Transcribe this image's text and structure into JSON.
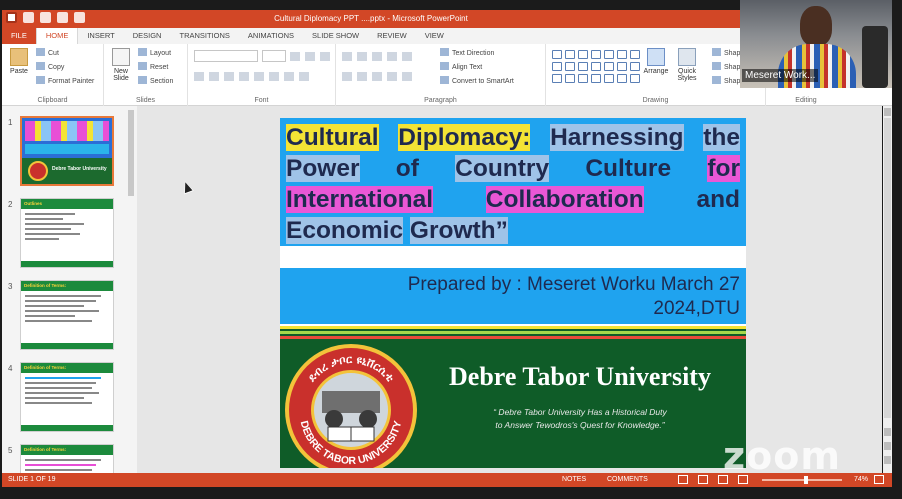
{
  "window": {
    "title": "Cultural Diplomacy  PPT ....pptx - Microsoft PowerPoint"
  },
  "ribbon_tabs": [
    "FILE",
    "HOME",
    "INSERT",
    "DESIGN",
    "TRANSITIONS",
    "ANIMATIONS",
    "SLIDE SHOW",
    "REVIEW",
    "VIEW"
  ],
  "active_tab": "HOME",
  "ribbon": {
    "clipboard": {
      "paste": "Paste",
      "cut": "Cut",
      "copy": "Copy",
      "format_painter": "Format Painter",
      "label": "Clipboard"
    },
    "slides": {
      "new_slide": "New Slide",
      "layout": "Layout",
      "reset": "Reset",
      "section": "Section",
      "label": "Slides"
    },
    "font": {
      "label": "Font"
    },
    "paragraph": {
      "text_direction": "Text Direction",
      "align_text": "Align Text",
      "convert_smartart": "Convert to SmartArt",
      "label": "Paragraph"
    },
    "drawing": {
      "arrange": "Arrange",
      "quick_styles": "Quick Styles",
      "shape_fill": "Shape F",
      "shape_outline": "Shape O",
      "shape_effects": "Shape E",
      "label": "Drawing"
    },
    "editing": {
      "label": "Editing"
    }
  },
  "webcam": {
    "participant_name": "Meseret Work..."
  },
  "thumbnails": [
    {
      "number": "1",
      "caption": "Debre Tabor University"
    },
    {
      "number": "2",
      "caption": "Outlines"
    },
    {
      "number": "3",
      "caption": "Definition of Terms:"
    },
    {
      "number": "4",
      "caption": "Definition of Terms:"
    },
    {
      "number": "5",
      "caption": "Definition of Terms:"
    }
  ],
  "slide": {
    "title_words": [
      {
        "text": "Cultural",
        "hl": "y"
      },
      {
        "text": "Diplomacy:",
        "hl": "y"
      },
      {
        "text": "Harnessing",
        "hl": "l"
      },
      {
        "text": "the",
        "hl": "l"
      },
      {
        "text": "Power",
        "hl": "l"
      },
      {
        "text": "of",
        "hl": ""
      },
      {
        "text": "Country",
        "hl": "l"
      },
      {
        "text": "Culture",
        "hl": ""
      },
      {
        "text": "for",
        "hl": "p"
      },
      {
        "text": "International",
        "hl": "p"
      },
      {
        "text": "Collaboration",
        "hl": "p"
      },
      {
        "text": "and",
        "hl": ""
      },
      {
        "text": "Economic",
        "hl": "l"
      },
      {
        "text": "Growth”",
        "hl": "l"
      }
    ],
    "prepared_line1": "Prepared by : Meseret Worku March 27",
    "prepared_line2": "2024,DTU",
    "university_name": "Debre Tabor University",
    "motto_line1": "“ Debre Tabor University Has a Historical Duty",
    "motto_line2": "to Answer Tewodros's Quest for Knowledge.”",
    "seal_text_top": "ደብረ ታቦር ዩኒቨርሲቲ",
    "seal_text_bottom": "DEBRE TABOR UNIVERSITY"
  },
  "watermark": "zoom",
  "status": {
    "slide_info": "SLIDE 1 OF 19",
    "notes": "NOTES",
    "comments": "COMMENTS",
    "zoom": "74%"
  },
  "colors": {
    "accent": "#d24726",
    "slide_blue": "#1fa3ef",
    "slide_green": "#0f5c28",
    "highlight_yellow": "#f3e335",
    "highlight_pink": "#ea57d6"
  }
}
